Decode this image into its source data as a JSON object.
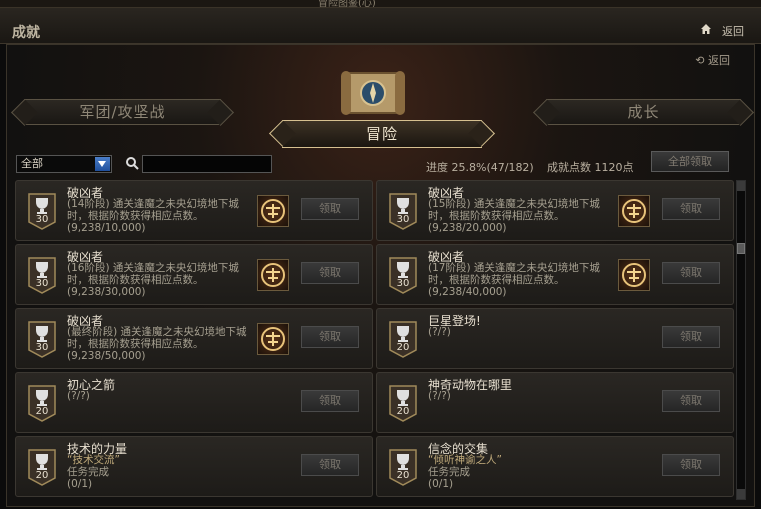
{
  "window": {
    "title_fragment": "冒险图鉴(心)"
  },
  "header": {
    "title": "成就",
    "back_label": "返回"
  },
  "panel": {
    "back_label": "返回"
  },
  "tabs": [
    {
      "label": "军团/攻坚战",
      "active": false
    },
    {
      "label": "冒险",
      "active": true
    },
    {
      "label": "成长",
      "active": false
    }
  ],
  "filter": {
    "selected": "全部"
  },
  "search": {
    "placeholder": "",
    "value": ""
  },
  "progress": {
    "label": "进度",
    "value": "25.8%(47/182)"
  },
  "points": {
    "label": "成就点数",
    "value": "1120点"
  },
  "claim_all_label": "全部领取",
  "achievements": [
    {
      "title": "破凶者",
      "desc": "(14阶段) 通关逢魔之未央幻境地下城时，根据阶数获得相应点数。",
      "progress": "(9,238/10,000)",
      "points": "30",
      "has_reward_icon": true,
      "claim": "领取"
    },
    {
      "title": "破凶者",
      "desc": "(15阶段) 通关逢魔之未央幻境地下城时，根据阶数获得相应点数。",
      "progress": "(9,238/20,000)",
      "points": "30",
      "has_reward_icon": true,
      "claim": "领取"
    },
    {
      "title": "破凶者",
      "desc": "(16阶段) 通关逢魔之未央幻境地下城时，根据阶数获得相应点数。",
      "progress": "(9,238/30,000)",
      "points": "30",
      "has_reward_icon": true,
      "claim": "领取"
    },
    {
      "title": "破凶者",
      "desc": "(17阶段) 通关逢魔之未央幻境地下城时，根据阶数获得相应点数。",
      "progress": "(9,238/40,000)",
      "points": "30",
      "has_reward_icon": true,
      "claim": "领取"
    },
    {
      "title": "破凶者",
      "desc": "(最终阶段) 通关逢魔之未央幻境地下城时，根据阶数获得相应点数。",
      "progress": "(9,238/50,000)",
      "points": "30",
      "has_reward_icon": true,
      "claim": "领取"
    },
    {
      "title": "巨星登场!",
      "desc": "",
      "progress": "(?/?)",
      "points": "20",
      "has_reward_icon": false,
      "claim": "领取"
    },
    {
      "title": "初心之箭",
      "desc": "",
      "progress": "(?/?)",
      "points": "20",
      "has_reward_icon": false,
      "claim": "领取"
    },
    {
      "title": "神奇动物在哪里",
      "desc": "",
      "progress": "(?/?)",
      "points": "20",
      "has_reward_icon": false,
      "claim": "领取"
    },
    {
      "title": "技术的力量",
      "quote": "“技术交流”",
      "desc": "任务完成",
      "progress": "(0/1)",
      "points": "20",
      "has_reward_icon": false,
      "claim": "领取"
    },
    {
      "title": "信念的交集",
      "quote": "“倾听神谕之人”",
      "desc": "任务完成",
      "progress": "(0/1)",
      "points": "20",
      "has_reward_icon": false,
      "claim": "领取"
    }
  ],
  "icons": {
    "home": "home-icon",
    "back": "back-arrow-icon",
    "search": "search-icon",
    "trophy": "trophy-icon",
    "reward": "reward-emblem-icon",
    "scroll": "scroll-emblem-icon"
  }
}
